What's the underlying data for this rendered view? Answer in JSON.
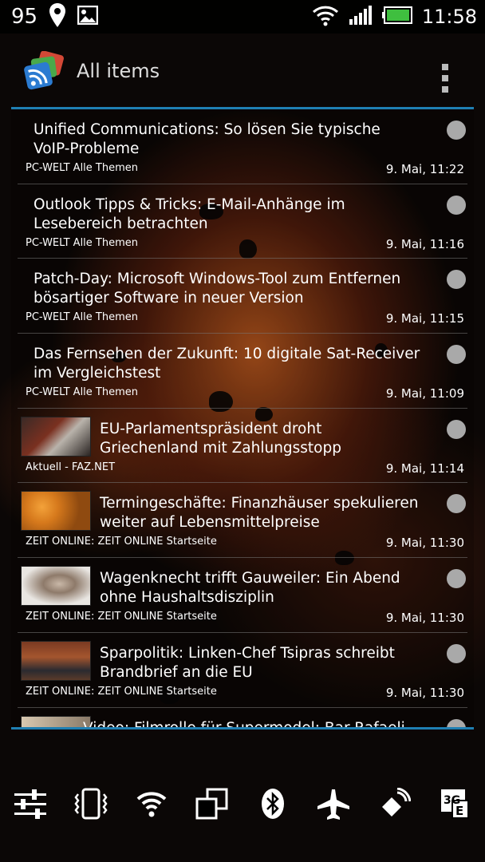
{
  "status_bar": {
    "notification_count": "95",
    "icons": [
      "location-pin-icon",
      "image-icon",
      "wifi-icon",
      "signal-icon",
      "battery-icon"
    ],
    "time": "11:58"
  },
  "app_bar": {
    "title": "All items",
    "logo_icon": "rss-reader-icon",
    "menu_icon": "overflow-menu-icon"
  },
  "items": [
    {
      "title": "Unified Communications: So lösen Sie typische VoIP-Probleme",
      "source": "PC-WELT Alle Themen",
      "date": "9. Mai, 11:22",
      "thumb": null
    },
    {
      "title": "Outlook Tipps & Tricks: E-Mail-Anhänge im Lesebereich betrachten",
      "source": "PC-WELT Alle Themen",
      "date": "9. Mai, 11:16",
      "thumb": null
    },
    {
      "title": "Patch-Day: Microsoft Windows-Tool zum Entfernen bösartiger Software in neuer Version",
      "source": "PC-WELT Alle Themen",
      "date": "9. Mai, 11:15",
      "thumb": null
    },
    {
      "title": "Das Fernsehen der Zukunft: 10 digitale Sat-Receiver im Vergleichstest",
      "source": "PC-WELT Alle Themen",
      "date": "9. Mai, 11:09",
      "thumb": null
    },
    {
      "title": "EU-Parlamentspräsident droht Griechenland mit Zahlungsstopp",
      "source": "Aktuell - FAZ.NET",
      "date": "9. Mai, 11:14",
      "thumb": "news-photo-thumbnail"
    },
    {
      "title": "Termingeschäfte: Finanzhäuser spekulieren weiter auf Lebensmittelpreise",
      "source": "ZEIT ONLINE: ZEIT ONLINE Startseite",
      "date": "9. Mai, 11:30",
      "thumb": "news-photo-thumbnail"
    },
    {
      "title": "Wagenknecht trifft Gauweiler: Ein Abend ohne Haushaltsdisziplin",
      "source": "ZEIT ONLINE: ZEIT ONLINE Startseite",
      "date": "9. Mai, 11:30",
      "thumb": "news-photo-thumbnail"
    },
    {
      "title": "Sparpolitik: Linken-Chef Tsipras schreibt Brandbrief an die EU",
      "source": "ZEIT ONLINE: ZEIT ONLINE Startseite",
      "date": "9. Mai, 11:30",
      "thumb": "news-photo-thumbnail"
    },
    {
      "title": "Video: Filmrolle für Supermodel: Bar Rafaeli",
      "source": "",
      "date": "",
      "thumb": "news-photo-thumbnail"
    }
  ],
  "quick_settings": [
    "settings-sliders-icon",
    "vibrate-icon",
    "wifi-toggle-icon",
    "screen-rotation-icon",
    "bluetooth-icon",
    "airplane-mode-icon",
    "gps-icon",
    "mobile-data-3g-icon"
  ],
  "colors": {
    "accent": "#1f7fb3",
    "unread_dot": "#a9a9a9"
  }
}
